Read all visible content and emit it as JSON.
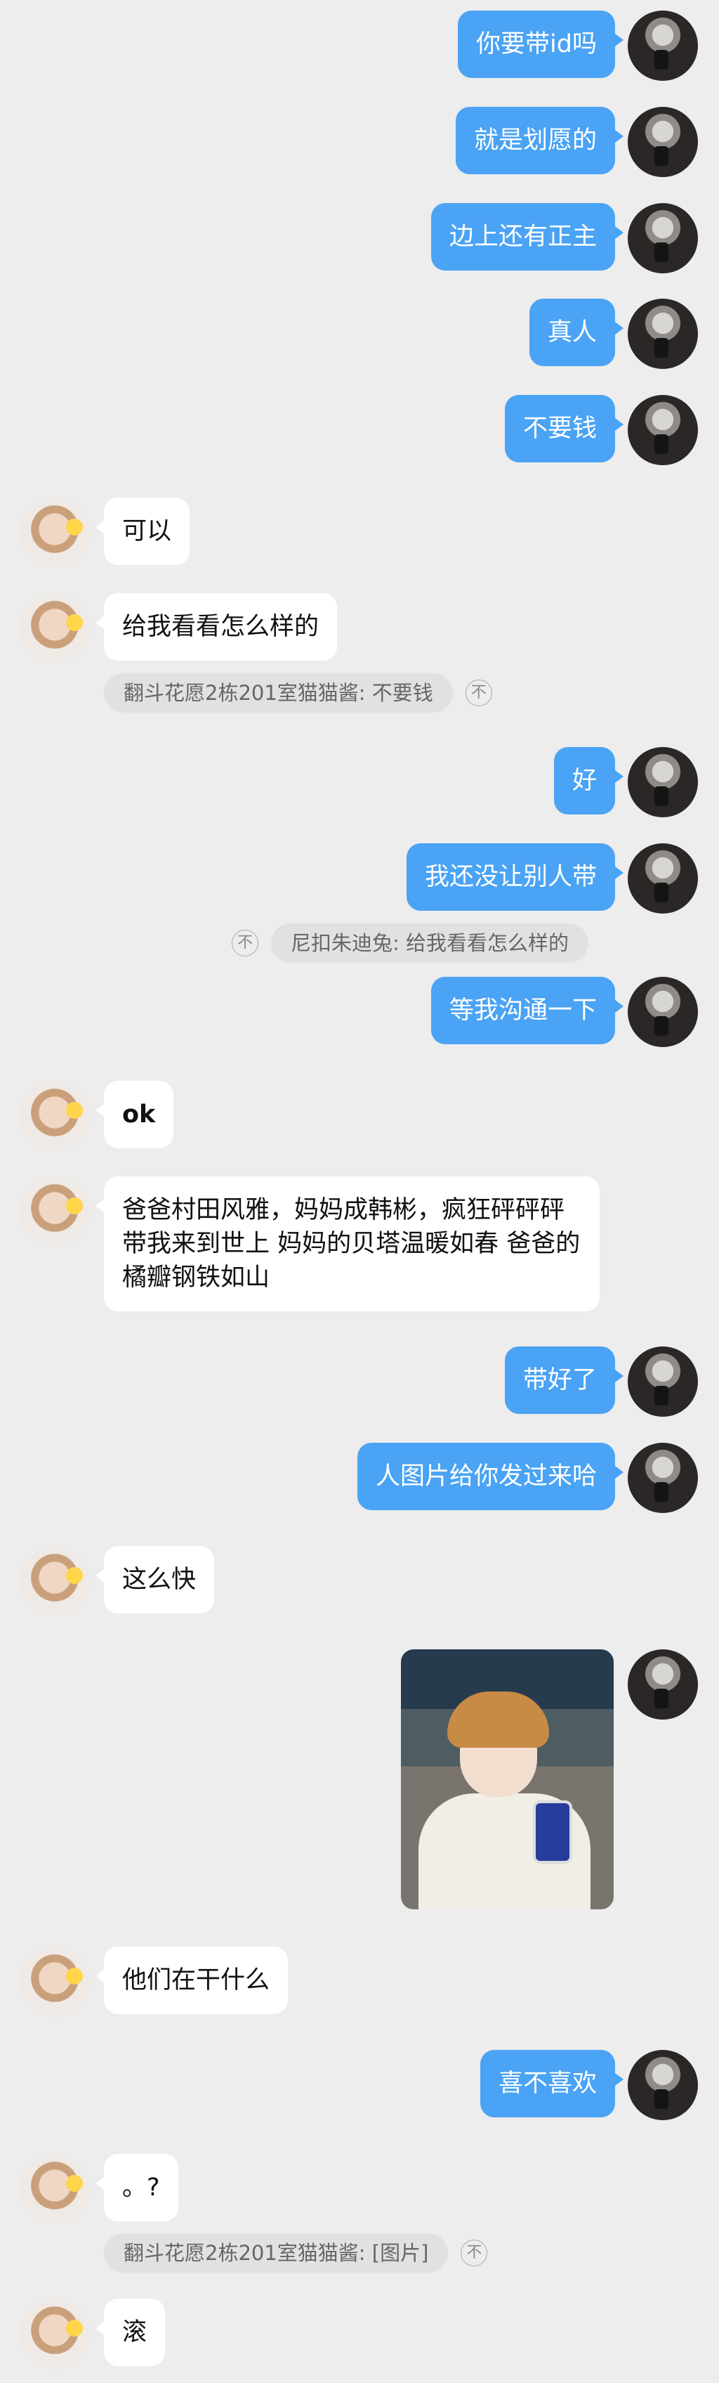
{
  "messages": [
    {
      "text": "你要带id吗"
    },
    {
      "text": "就是划愿的"
    },
    {
      "text": "边上还有正主"
    },
    {
      "text": "真人"
    },
    {
      "text": "不要钱"
    },
    {
      "text": "可以"
    },
    {
      "text": "给我看看怎么样的"
    },
    {
      "quote": "翻斗花愿2栋201室猫猫酱: 不要钱"
    },
    {
      "text": "好"
    },
    {
      "text": "我还没让别人带"
    },
    {
      "quote": "尼扣朱迪兔: 给我看看怎么样的"
    },
    {
      "text": "等我沟通一下"
    },
    {
      "text": "ok"
    },
    {
      "text": "爸爸村田风雅，妈妈成韩彬，疯狂砰砰砰带我来到世上 妈妈的贝塔温暖如春 爸爸的橘瓣钢铁如山"
    },
    {
      "text": "带好了"
    },
    {
      "text": "人图片给你发过来哈"
    },
    {
      "text": "这么快"
    },
    {
      "text": "他们在干什么"
    },
    {
      "text": "喜不喜欢"
    },
    {
      "text": "。?"
    },
    {
      "quote": "翻斗花愿2栋201室猫猫酱: [图片]"
    },
    {
      "text": "滚"
    }
  ],
  "icons": {
    "quote_action": "不"
  }
}
